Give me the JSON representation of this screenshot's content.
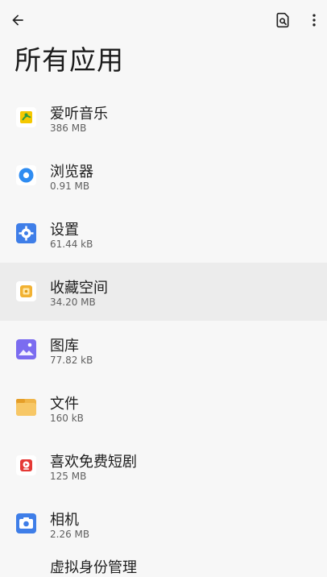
{
  "page": {
    "title": "所有应用"
  },
  "toolbar": {
    "back_icon": "arrow-back-icon",
    "search_icon": "search-document-icon",
    "more_icon": "more-vert-icon"
  },
  "apps": [
    {
      "name": "爱听音乐",
      "size": "386 MB",
      "icon": "music-app-icon",
      "color": "#f2c400"
    },
    {
      "name": "浏览器",
      "size": "0.91 MB",
      "icon": "browser-app-icon",
      "color": "#2f8cf1"
    },
    {
      "name": "设置",
      "size": "61.44 kB",
      "icon": "settings-app-icon",
      "color": "#3f7ee8"
    },
    {
      "name": "收藏空间",
      "size": "34.20 MB",
      "icon": "collection-app-icon",
      "color": "#f2b233"
    },
    {
      "name": "图库",
      "size": "77.82 kB",
      "icon": "gallery-app-icon",
      "color": "#7b6cf0"
    },
    {
      "name": "文件",
      "size": "160 kB",
      "icon": "files-app-icon",
      "color": "#f0b548"
    },
    {
      "name": "喜欢免费短剧",
      "size": "125 MB",
      "icon": "drama-app-icon",
      "color": "#e53935"
    },
    {
      "name": "相机",
      "size": "2.26 MB",
      "icon": "camera-app-icon",
      "color": "#3f7ee8"
    }
  ],
  "partial_app": {
    "name": "虚拟身份管理"
  }
}
